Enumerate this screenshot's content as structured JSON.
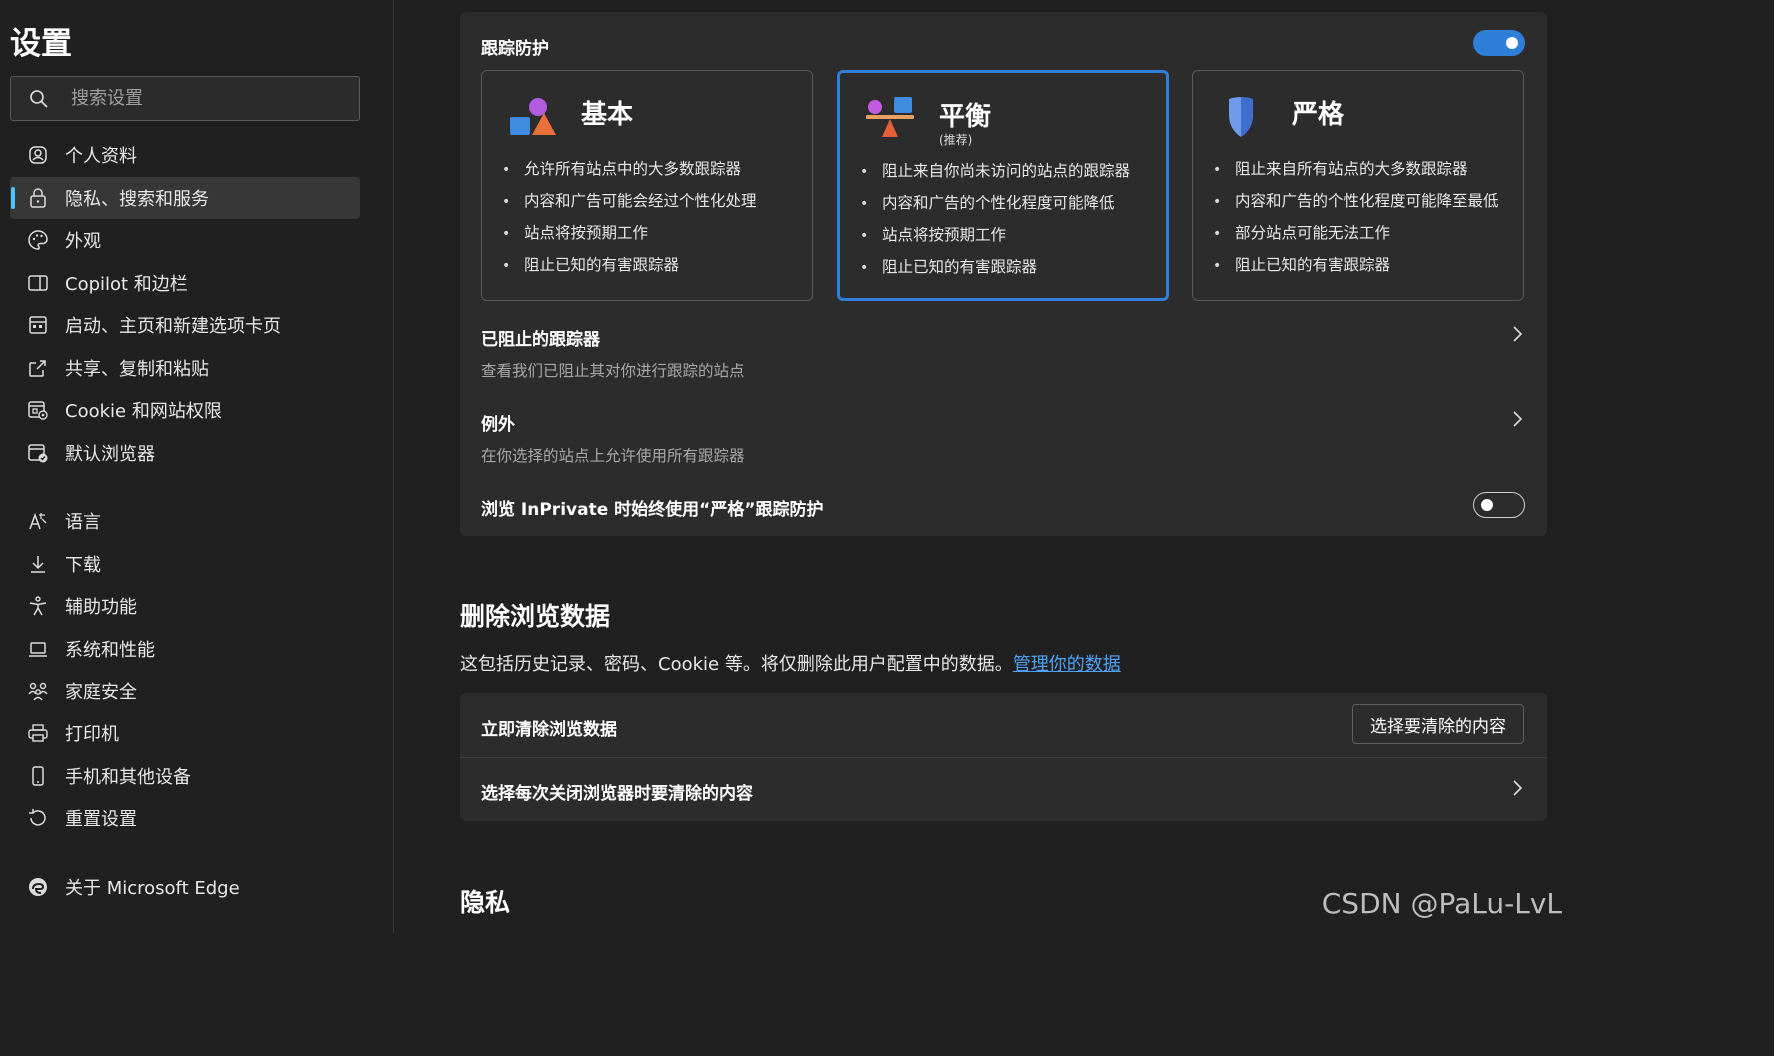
{
  "sidebar": {
    "title": "设置",
    "search_placeholder": "搜索设置",
    "items": [
      {
        "label": "个人资料",
        "icon": "profile-icon"
      },
      {
        "label": "隐私、搜索和服务",
        "icon": "lock-icon",
        "active": true
      },
      {
        "label": "外观",
        "icon": "palette-icon"
      },
      {
        "label": "Copilot 和边栏",
        "icon": "sidebar-icon"
      },
      {
        "label": "启动、主页和新建选项卡页",
        "icon": "home-tabs-icon"
      },
      {
        "label": "共享、复制和粘贴",
        "icon": "share-icon"
      },
      {
        "label": "Cookie 和网站权限",
        "icon": "site-permissions-icon"
      },
      {
        "label": "默认浏览器",
        "icon": "default-browser-icon"
      },
      {
        "label": "语言",
        "icon": "language-icon"
      },
      {
        "label": "下载",
        "icon": "download-icon"
      },
      {
        "label": "辅助功能",
        "icon": "accessibility-icon"
      },
      {
        "label": "系统和性能",
        "icon": "laptop-icon"
      },
      {
        "label": "家庭安全",
        "icon": "family-icon"
      },
      {
        "label": "打印机",
        "icon": "printer-icon"
      },
      {
        "label": "手机和其他设备",
        "icon": "phone-icon"
      },
      {
        "label": "重置设置",
        "icon": "reset-icon"
      },
      {
        "label": "关于 Microsoft Edge",
        "icon": "edge-logo-icon"
      }
    ]
  },
  "tracking": {
    "title": "跟踪防护",
    "enabled": true,
    "levels": [
      {
        "title": "基本",
        "subtitle": "",
        "selected": false,
        "bullets": [
          "允许所有站点中的大多数跟踪器",
          "内容和广告可能会经过个性化处理",
          "站点将按预期工作",
          "阻止已知的有害跟踪器"
        ]
      },
      {
        "title": "平衡",
        "subtitle": "(推荐)",
        "selected": true,
        "bullets": [
          "阻止来自你尚未访问的站点的跟踪器",
          "内容和广告的个性化程度可能降低",
          "站点将按预期工作",
          "阻止已知的有害跟踪器"
        ]
      },
      {
        "title": "严格",
        "subtitle": "",
        "selected": false,
        "bullets": [
          "阻止来自所有站点的大多数跟踪器",
          "内容和广告的个性化程度可能降至最低",
          "部分站点可能无法工作",
          "阻止已知的有害跟踪器"
        ]
      }
    ],
    "blocked": {
      "title": "已阻止的跟踪器",
      "desc": "查看我们已阻止其对你进行跟踪的站点"
    },
    "exceptions": {
      "title": "例外",
      "desc": "在你选择的站点上允许使用所有跟踪器"
    },
    "inprivate": {
      "title": "浏览 InPrivate 时始终使用“严格”跟踪防护",
      "enabled": false
    }
  },
  "clear_data": {
    "title": "删除浏览数据",
    "desc": "这包括历史记录、密码、Cookie 等。将仅删除此用户配置中的数据。",
    "link": "管理你的数据",
    "now_title": "立即清除浏览数据",
    "now_button": "选择要清除的内容",
    "on_close_title": "选择每次关闭浏览器时要清除的内容"
  },
  "privacy": {
    "title": "隐私"
  },
  "watermark": "CSDN @PaLu-LvL",
  "colors": {
    "accent": "#2f7fd8",
    "link": "#4fa3f7",
    "background": "#202020",
    "card": "#2c2c2c"
  }
}
